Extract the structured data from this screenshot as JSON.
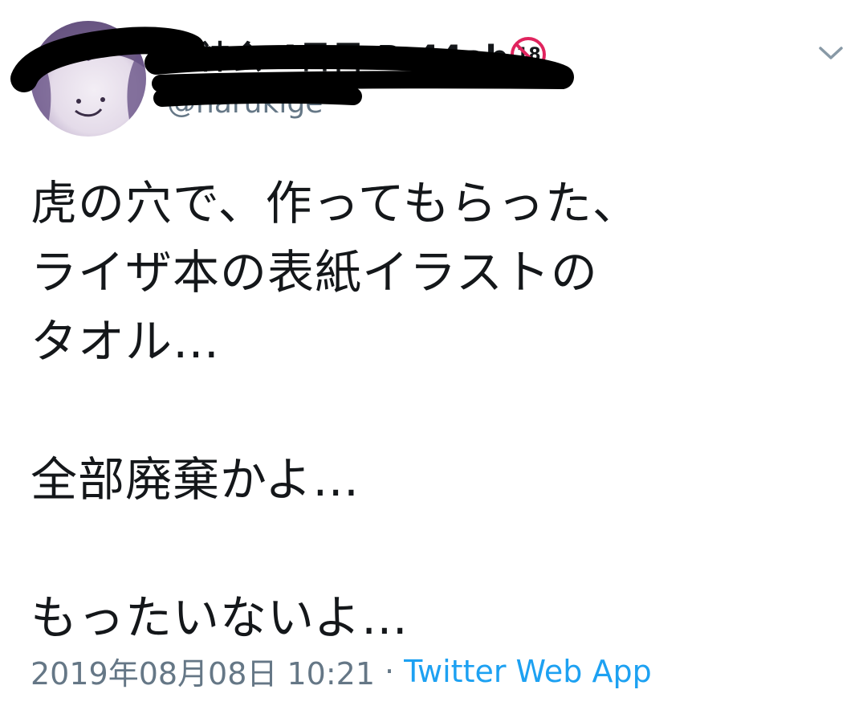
{
  "header": {
    "display_name": "雷神会 4日目 R-44ab",
    "age_badge": "18",
    "handle": "@harukige",
    "menu_icon": "chevron-down-icon"
  },
  "tweet": {
    "text": "虎の穴で、作ってもらった、\nライザ本の表紙イラストの\nタオル…\n\n全部廃棄かよ…\n\nもったいないよ…"
  },
  "footer": {
    "timestamp": "2019年08月08日 10:21",
    "separator": "·",
    "source": "Twitter Web App"
  },
  "colors": {
    "text": "#14171a",
    "secondary": "#657786",
    "link": "#1da1f2",
    "badge_ring": "#e0245e",
    "redaction": "#000000"
  }
}
